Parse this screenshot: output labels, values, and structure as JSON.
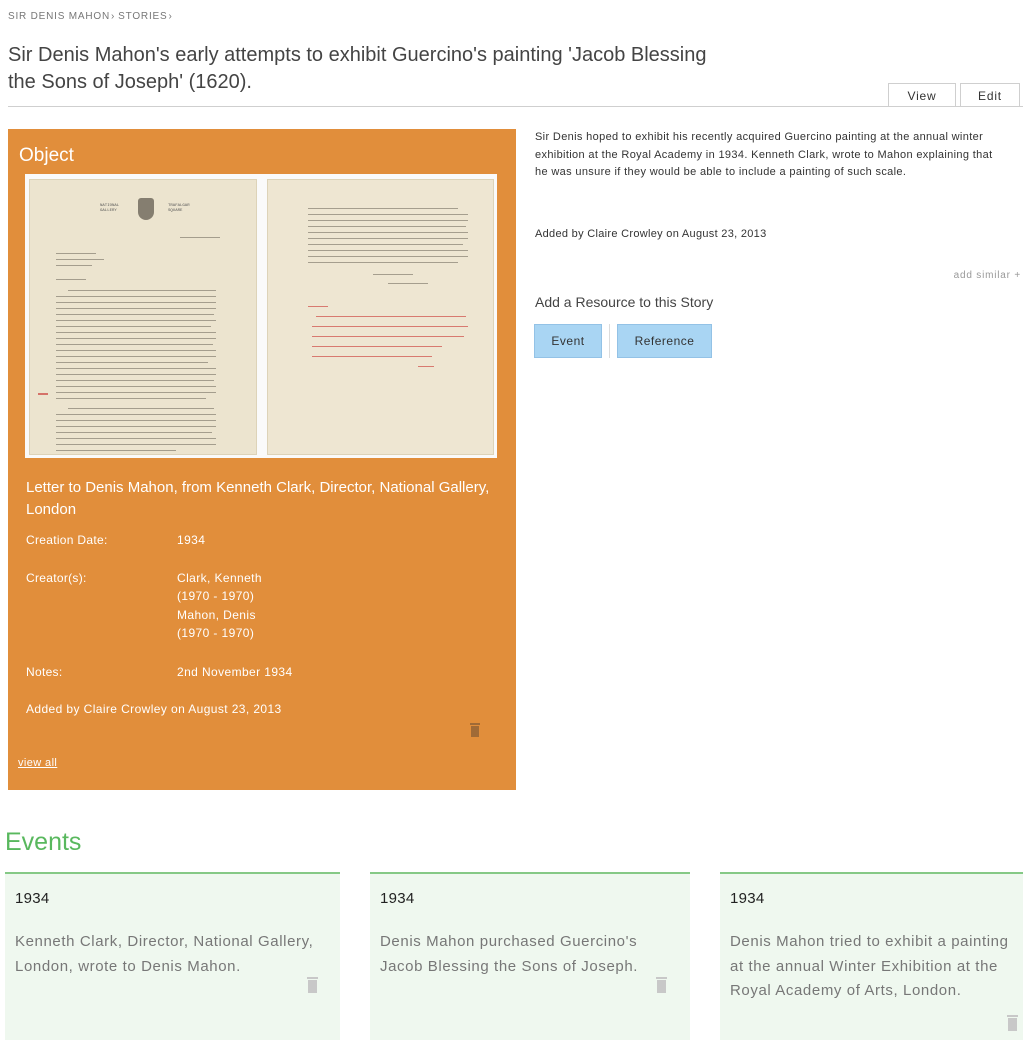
{
  "breadcrumb": [
    {
      "label": "SIR DENIS MAHON"
    },
    {
      "label": "STORIES"
    }
  ],
  "breadcrumb_separator": "›",
  "page": {
    "title_line1": "Sir Denis Mahon's early attempts to exhibit Guercino's painting 'Jacob Blessing",
    "title_line2": "the Sons of Joseph' (1620)."
  },
  "tabs": {
    "view": "View",
    "edit": "Edit"
  },
  "object": {
    "heading": "Object",
    "letterhead_left": "NATIONAL\nGALLERY",
    "letterhead_right": "TRAFALGAR\nSQUARE",
    "title": "Letter to Denis Mahon, from Kenneth Clark, Director, National Gallery, London",
    "creation_date_label": "Creation Date:",
    "creation_date": "1934",
    "creators_label": "Creator(s):",
    "creators": [
      {
        "name": "Clark, Kenneth",
        "dates": "(1970 - 1970)"
      },
      {
        "name": "Mahon, Denis",
        "dates": "(1970 - 1970)"
      }
    ],
    "notes_label": "Notes:",
    "notes": "2nd November 1934",
    "added_by": "Added by Claire Crowley on August 23, 2013",
    "view_all": "view all",
    "panel_color": "#e18e3b"
  },
  "story": {
    "text": "Sir Denis hoped to exhibit his recently acquired Guercino painting at the annual winter exhibition at the Royal Academy in 1934. Kenneth Clark, wrote to Mahon explaining that he was unsure if they would be able to include a painting of such scale.",
    "added_by": "Added by Claire Crowley on August 23, 2013",
    "add_similar": "add similar +",
    "resource_heading": "Add a Resource to this Story",
    "buttons": {
      "event": "Event",
      "reference": "Reference"
    },
    "button_color": "#a9d5f3"
  },
  "events": {
    "heading": "Events",
    "accent_color": "#59b85e",
    "items": [
      {
        "year": "1934",
        "description": "Kenneth Clark, Director, National Gallery, London, wrote to Denis Mahon."
      },
      {
        "year": "1934",
        "description": "Denis Mahon purchased Guercino's Jacob Blessing the Sons of Joseph."
      },
      {
        "year": "1934",
        "description": "Denis Mahon tried to exhibit a painting at the annual Winter Exhibition at the Royal Academy of Arts, London."
      }
    ]
  },
  "icons": {
    "delete": "trash-icon",
    "letter_image": "letter-scan-image"
  }
}
